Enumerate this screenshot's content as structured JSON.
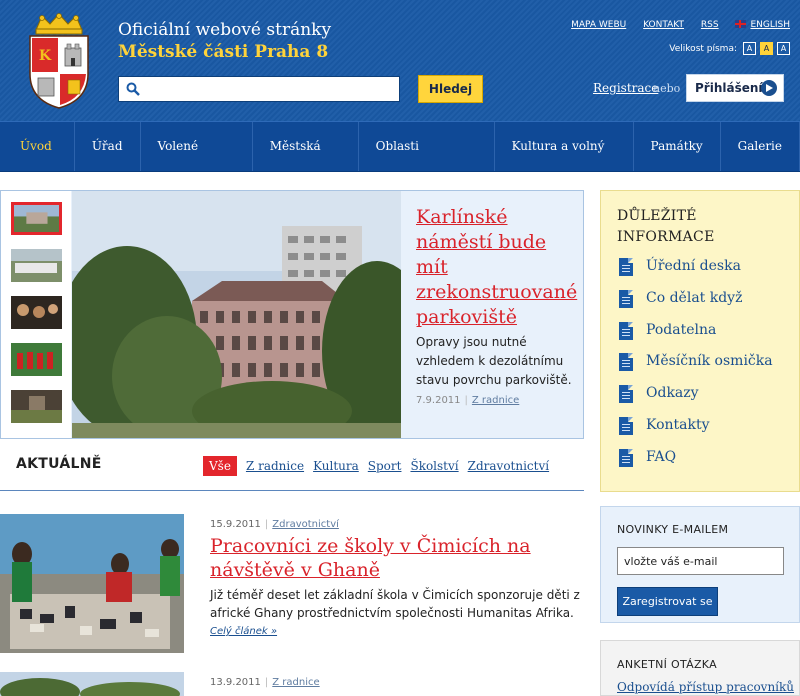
{
  "header": {
    "title_line1": "Oficiální webové stránky",
    "title_line2": "Městské části Praha 8",
    "search": {
      "placeholder": "",
      "button_label": "Hledej"
    },
    "top_links": {
      "sitemap": "MAPA WEBU",
      "contact": "KONTAKT",
      "rss": "RSS",
      "english": "ENGLISH"
    },
    "font_size": {
      "label": "Velikost písma:",
      "options": [
        "A",
        "A",
        "A"
      ],
      "selected_index": 1
    },
    "register_label": "Registrace",
    "or_label": "nebo",
    "login_label": "Přihlášení",
    "colors": {
      "header_bg": "#1a5aa6",
      "accent_yellow": "#ffd33a",
      "accent_red": "#e3262c"
    }
  },
  "nav": {
    "items": [
      "Úvod",
      "Úřad",
      "Volené orgány",
      "Městská část",
      "Oblasti působnosti",
      "Kultura a volný čas",
      "Památky",
      "Galerie"
    ],
    "active_index": 0
  },
  "feature": {
    "title": "Karlínské náměstí bude mít zrekonstruované parkoviště",
    "description": "Opravy jsou nutné vzhledem k dezolátnímu stavu povrchu parkoviště.",
    "date": "7.9.2011",
    "category": "Z radnice",
    "selected_thumb": 0
  },
  "news": {
    "heading": "AKTUÁLNĚ",
    "tabs": [
      "Vše",
      "Z radnice",
      "Kultura",
      "Sport",
      "Školství",
      "Zdravotnictví"
    ],
    "active_tab": 0,
    "articles": [
      {
        "date": "15.9.2011",
        "category": "Zdravotnictví",
        "title": "Pracovníci ze školy v Čimicích na návštěvě v Ghaně",
        "text": "Již téměř deset let základní škola v Čimicích sponzoruje děti z africké Ghany prostřednictvím společnosti Humanitas Afrika.",
        "more_label": "Celý článek »"
      },
      {
        "date": "13.9.2011",
        "category": "Z radnice"
      }
    ]
  },
  "sidebar": {
    "important": {
      "title": "DŮLEŽITÉ INFORMACE",
      "items": [
        "Úřední deska",
        "Co dělat když",
        "Podatelna",
        "Měsíčník osmička",
        "Odkazy",
        "Kontakty",
        "FAQ"
      ]
    },
    "newsletter": {
      "title": "NOVINKY E-MAILEM",
      "input_value": "vložte váš e-mail",
      "button_label": "Zaregistrovat se"
    },
    "poll": {
      "title": "ANKETNÍ OTÁZKA",
      "question": "Odpovídá přístup pracovníků"
    }
  }
}
